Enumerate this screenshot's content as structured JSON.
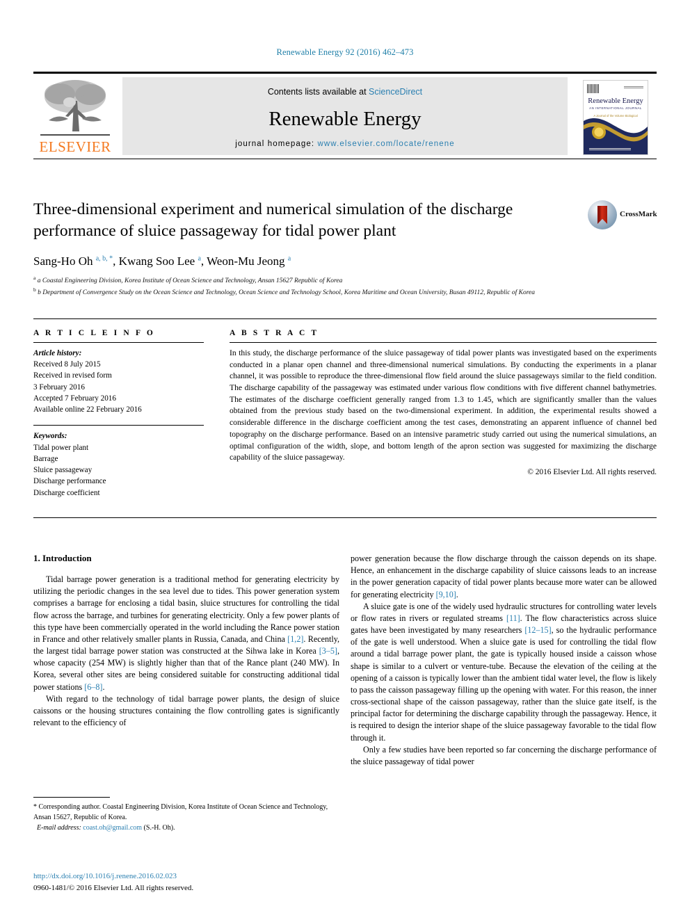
{
  "running_head": "Renewable Energy 92 (2016) 462–473",
  "masthead": {
    "contents_prefix": "Contents lists available at ",
    "sciencedirect": "ScienceDirect",
    "journal_title": "Renewable Energy",
    "homepage_prefix": "journal homepage: ",
    "homepage_url": "www.elsevier.com/locate/renene",
    "publisher_wordmark": "ELSEVIER",
    "cover": {
      "title": "Renewable Energy",
      "subtitle": "AN INTERNATIONAL JOURNAL",
      "tagline": "A Journal of the Volume Biological"
    }
  },
  "article": {
    "title": "Three-dimensional experiment and numerical simulation of the discharge performance of sluice passageway for tidal power plant",
    "crossmark_label": "CrossMark",
    "authors_html": "Sang-Ho Oh <sup>a, b, *</sup>, Kwang Soo Lee <sup>a</sup>, Weon-Mu Jeong <sup>a</sup>",
    "affiliations": [
      "a Coastal Engineering Division, Korea Institute of Ocean Science and Technology, Ansan 15627 Republic of Korea",
      "b Department of Convergence Study on the Ocean Science and Technology, Ocean Science and Technology School, Korea Maritime and Ocean University, Busan 49112, Republic of Korea"
    ]
  },
  "article_info": {
    "heading": "A R T I C L E   I N F O",
    "history_label": "Article history:",
    "history": [
      "Received 8 July 2015",
      "Received in revised form",
      "3 February 2016",
      "Accepted 7 February 2016",
      "Available online 22 February 2016"
    ],
    "keywords_label": "Keywords:",
    "keywords": [
      "Tidal power plant",
      "Barrage",
      "Sluice passageway",
      "Discharge performance",
      "Discharge coefficient"
    ]
  },
  "abstract": {
    "heading": "A B S T R A C T",
    "text": "In this study, the discharge performance of the sluice passageway of tidal power plants was investigated based on the experiments conducted in a planar open channel and three-dimensional numerical simulations. By conducting the experiments in a planar channel, it was possible to reproduce the three-dimensional flow field around the sluice passageways similar to the field condition. The discharge capability of the passageway was estimated under various flow conditions with five different channel bathymetries. The estimates of the discharge coefficient generally ranged from 1.3 to 1.45, which are significantly smaller than the values obtained from the previous study based on the two-dimensional experiment. In addition, the experimental results showed a considerable difference in the discharge coefficient among the test cases, demonstrating an apparent influence of channel bed topography on the discharge performance. Based on an intensive parametric study carried out using the numerical simulations, an optimal configuration of the width, slope, and bottom length of the apron section was suggested for maximizing the discharge capability of the sluice passageway.",
    "copyright": "© 2016 Elsevier Ltd. All rights reserved."
  },
  "body": {
    "section_heading": "1. Introduction",
    "left_paragraphs": [
      {
        "html": "Tidal barrage power generation is a traditional method for generating electricity by utilizing the periodic changes in the sea level due to tides. This power generation system comprises a barrage for enclosing a tidal basin, sluice structures for controlling the tidal flow across the barrage, and turbines for generating electricity. Only a few power plants of this type have been commercially operated in the world including the Rance power station in France and other relatively smaller plants in Russia, Canada, and China <span class=\"ref\">[1,2]</span>. Recently, the largest tidal barrage power station was constructed at the Sihwa lake in Korea <span class=\"ref\">[3–5]</span>, whose capacity (254 MW) is slightly higher than that of the Rance plant (240 MW). In Korea, several other sites are being considered suitable for constructing additional tidal power stations <span class=\"ref\">[6–8]</span>."
      },
      {
        "html": "With regard to the technology of tidal barrage power plants, the design of sluice caissons or the housing structures containing the flow controlling gates is significantly relevant to the efficiency of"
      }
    ],
    "right_paragraphs": [
      {
        "html": "power generation because the flow discharge through the caisson depends on its shape. Hence, an enhancement in the discharge capability of sluice caissons leads to an increase in the power generation capacity of tidal power plants because more water can be allowed for generating electricity <span class=\"ref\">[9,10]</span>.",
        "indent": false
      },
      {
        "html": "A sluice gate is one of the widely used hydraulic structures for controlling water levels or flow rates in rivers or regulated streams <span class=\"ref\">[11]</span>. The flow characteristics across sluice gates have been investigated by many researchers <span class=\"ref\">[12–15]</span>, so the hydraulic performance of the gate is well understood. When a sluice gate is used for controlling the tidal flow around a tidal barrage power plant, the gate is typically housed inside a caisson whose shape is similar to a culvert or venture-tube. Because the elevation of the ceiling at the opening of a caisson is typically lower than the ambient tidal water level, the flow is likely to pass the caisson passageway filling up the opening with water. For this reason, the inner cross-sectional shape of the caisson passageway, rather than the sluice gate itself, is the principal factor for determining the discharge capability through the passageway. Hence, it is required to design the interior shape of the sluice passageway favorable to the tidal flow through it.",
        "indent": true
      },
      {
        "html": "Only a few studies have been reported so far concerning the discharge performance of the sluice passageway of tidal power",
        "indent": true
      }
    ]
  },
  "footnote": {
    "corresponding_html": "* Corresponding author. Coastal Engineering Division, Korea Institute of Ocean Science and Technology, Ansan 15627, Republic of Korea.",
    "email_label": "E-mail address:",
    "email": "coast.oh@gmail.com",
    "email_owner": "(S.-H. Oh)."
  },
  "doi": {
    "url": "http://dx.doi.org/10.1016/j.renene.2016.02.023",
    "issn_line": "0960-1481/© 2016 Elsevier Ltd. All rights reserved."
  },
  "colors": {
    "link": "#2a7fb0",
    "elsevier_orange": "#f47920",
    "band_grey": "#e6e6e6",
    "cover_navy": "#1f2a5e"
  }
}
